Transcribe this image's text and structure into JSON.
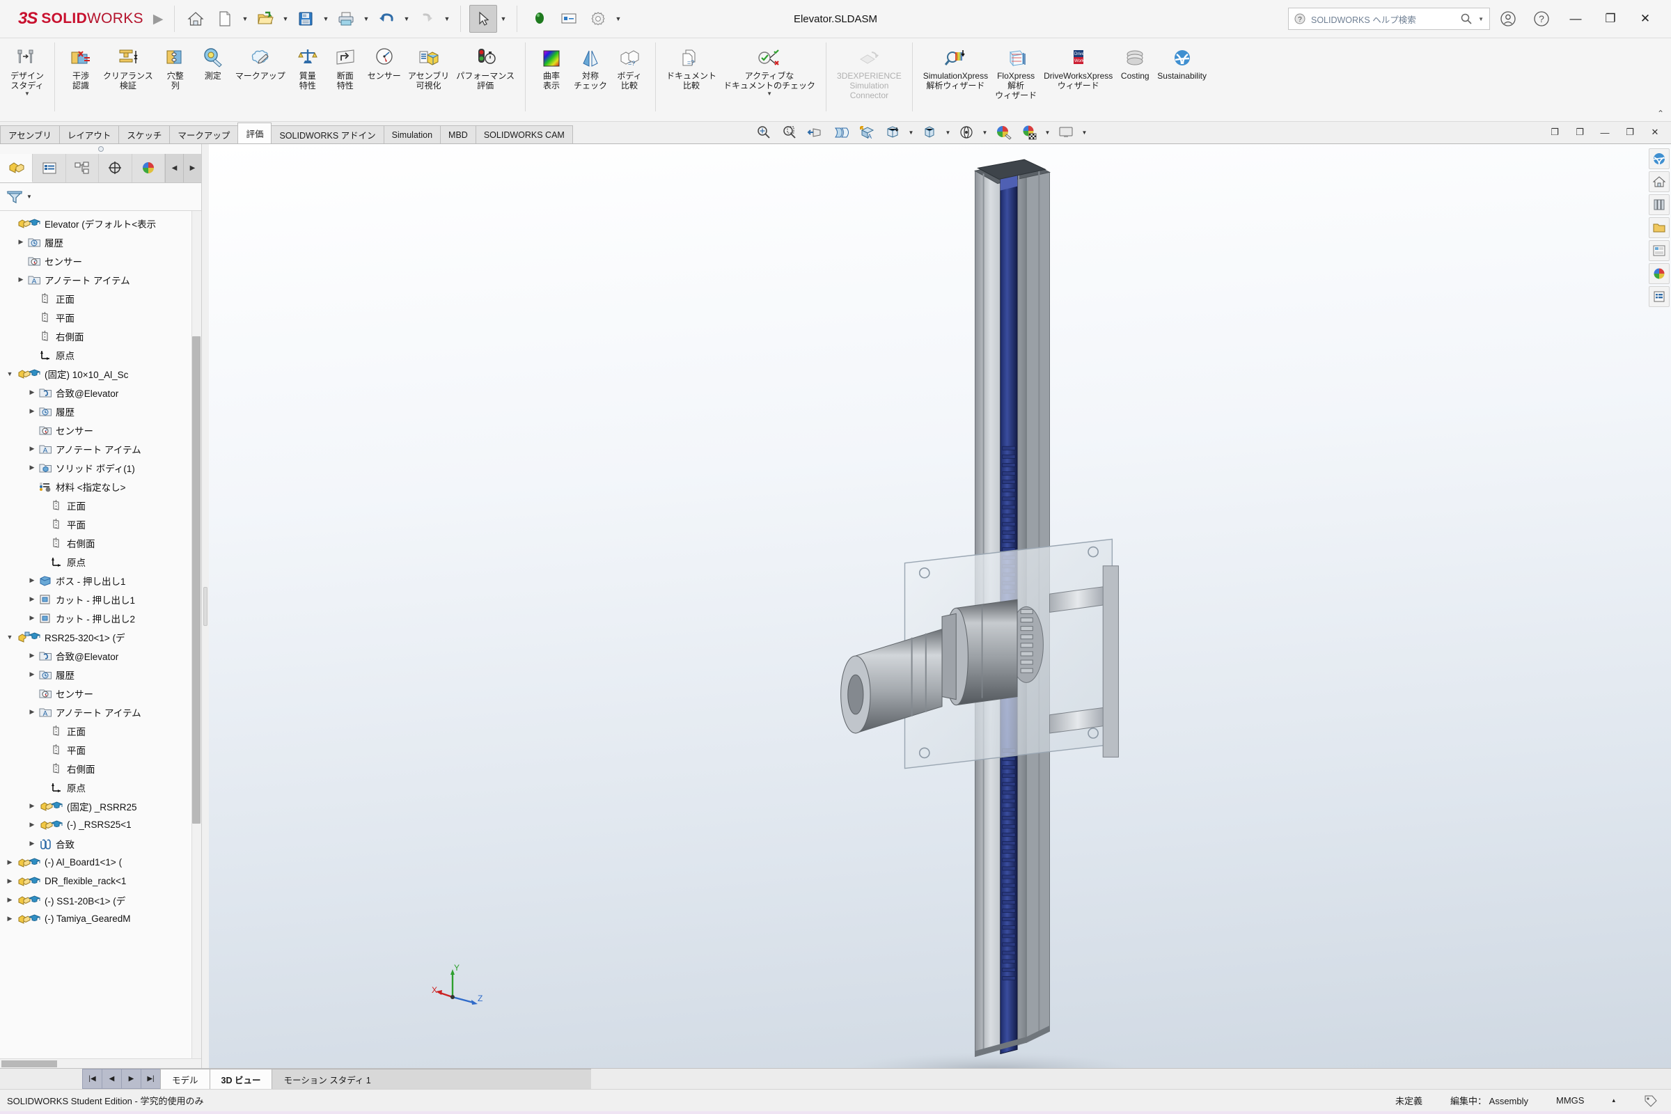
{
  "window": {
    "brand_ds": "3S",
    "brand_solid": "SOLID",
    "brand_works": "WORKS",
    "document_title": "Elevator.SLDASM",
    "search_placeholder": "SOLIDWORKS ヘルプ検索",
    "minimize_label": "—",
    "restore_label": "❐",
    "close_label": "✕"
  },
  "quick_access": [
    {
      "name": "home-icon",
      "label": "ホーム"
    },
    {
      "name": "new-document-icon",
      "label": "新規"
    },
    {
      "name": "open-document-icon",
      "label": "開く"
    },
    {
      "name": "save-icon",
      "label": "保存"
    },
    {
      "name": "print-icon",
      "label": "印刷"
    },
    {
      "name": "undo-icon",
      "label": "元に戻す"
    },
    {
      "name": "redo-icon",
      "label": "やり直し"
    },
    {
      "name": "select-icon",
      "label": "選択"
    },
    {
      "name": "rebuild-icon",
      "label": "再構築"
    },
    {
      "name": "options-display-icon",
      "label": "表示設定"
    },
    {
      "name": "settings-gear-icon",
      "label": "オプション"
    }
  ],
  "ribbon": {
    "groups": [
      {
        "items": [
          {
            "label": "デザイン\nスタディ",
            "icon": "design-study-icon",
            "disabled": false,
            "dropdown": true
          }
        ]
      },
      {
        "items": [
          {
            "label": "干渉\n認識",
            "icon": "interference-detection-icon"
          },
          {
            "label": "クリアランス\n検証",
            "icon": "clearance-verification-icon"
          },
          {
            "label": "穴整\n列",
            "icon": "hole-alignment-icon"
          },
          {
            "label": "測定",
            "icon": "measure-icon"
          },
          {
            "label": "マークアップ",
            "icon": "markup-icon"
          },
          {
            "label": "質量\n特性",
            "icon": "mass-properties-icon"
          },
          {
            "label": "断面\n特性",
            "icon": "section-properties-icon"
          },
          {
            "label": "センサー",
            "icon": "sensor-icon"
          },
          {
            "label": "アセンブリ\n可視化",
            "icon": "assembly-visualization-icon"
          },
          {
            "label": "パフォーマンス\n評価",
            "icon": "performance-evaluation-icon"
          }
        ]
      },
      {
        "items": [
          {
            "label": "曲率\n表示",
            "icon": "curvature-display-icon"
          },
          {
            "label": "対称\nチェック",
            "icon": "symmetry-check-icon"
          },
          {
            "label": "ボディ\n比較",
            "icon": "body-compare-icon"
          }
        ]
      },
      {
        "items": [
          {
            "label": "ドキュメント\n比較",
            "icon": "document-compare-icon"
          },
          {
            "label": "アクティブな\nドキュメントのチェック",
            "icon": "active-document-check-icon",
            "dropdown": true
          }
        ]
      },
      {
        "items": [
          {
            "label": "3DEXPERIENCE\nSimulation\nConnector",
            "icon": "3dexperience-simulation-icon",
            "disabled": true
          }
        ]
      },
      {
        "items": [
          {
            "label": "SimulationXpress\n解析ウィザード",
            "icon": "simulationxpress-icon"
          },
          {
            "label": "FloXpress\n解析\nウィザード",
            "icon": "floxpress-icon"
          },
          {
            "label": "DriveWorksXpress\nウィザード",
            "icon": "driveworksxpress-icon"
          },
          {
            "label": "Costing",
            "icon": "costing-icon"
          },
          {
            "label": "Sustainability",
            "icon": "sustainability-icon"
          }
        ]
      }
    ],
    "collapse_label": "⌃"
  },
  "command_tabs": [
    {
      "label": "アセンブリ",
      "active": false
    },
    {
      "label": "レイアウト",
      "active": false
    },
    {
      "label": "スケッチ",
      "active": false
    },
    {
      "label": "マークアップ",
      "active": false
    },
    {
      "label": "評価",
      "active": true
    },
    {
      "label": "SOLIDWORKS アドイン",
      "active": false
    },
    {
      "label": "Simulation",
      "active": false
    },
    {
      "label": "MBD",
      "active": false
    },
    {
      "label": "SOLIDWORKS CAM",
      "active": false
    }
  ],
  "view_toolbar": [
    {
      "name": "zoom-to-fit-icon",
      "dropdown": false
    },
    {
      "name": "zoom-to-area-icon",
      "dropdown": false
    },
    {
      "name": "previous-view-icon",
      "dropdown": false
    },
    {
      "name": "section-view-icon",
      "dropdown": false
    },
    {
      "name": "view-orientation-icon",
      "dropdown": false
    },
    {
      "name": "display-style-icon",
      "dropdown": true
    },
    {
      "name": "hide-show-items-icon",
      "dropdown": true
    },
    {
      "name": "edit-appearance-icon",
      "dropdown": false
    },
    {
      "name": "apply-scene-icon",
      "dropdown": true
    },
    {
      "name": "view-settings-icon",
      "dropdown": true
    }
  ],
  "document_window_controls": [
    {
      "name": "restore-doc-icon",
      "label": "❐"
    },
    {
      "name": "doc-window-icon",
      "label": "❐"
    },
    {
      "name": "minimize-doc-icon",
      "label": "—"
    },
    {
      "name": "maximize-doc-icon",
      "label": "❐"
    },
    {
      "name": "close-doc-icon",
      "label": "✕"
    }
  ],
  "feature_manager": {
    "tabs": [
      {
        "name": "feature-manager-tab",
        "active": true
      },
      {
        "name": "property-manager-tab",
        "active": false
      },
      {
        "name": "configuration-manager-tab",
        "active": false
      },
      {
        "name": "dimxpert-manager-tab",
        "active": false
      },
      {
        "name": "display-manager-tab",
        "active": false
      },
      {
        "name": "appearances-tab",
        "active": false
      }
    ],
    "nav_prev": "◀",
    "nav_next": "▶",
    "filter_placeholder": "",
    "tree": [
      {
        "label": "Elevator  (デフォルト<表示",
        "indent": 0,
        "arrow": "",
        "icon": "assembly-icon",
        "student": true
      },
      {
        "label": "履歴",
        "indent": 1,
        "arrow": "▶",
        "icon": "history-folder-icon"
      },
      {
        "label": "センサー",
        "indent": 1,
        "arrow": "",
        "icon": "sensor-folder-icon"
      },
      {
        "label": "アノテート アイテム",
        "indent": 1,
        "arrow": "▶",
        "icon": "annotations-folder-icon"
      },
      {
        "label": "正面",
        "indent": 2,
        "arrow": "",
        "icon": "plane-icon"
      },
      {
        "label": "平面",
        "indent": 2,
        "arrow": "",
        "icon": "plane-icon"
      },
      {
        "label": "右側面",
        "indent": 2,
        "arrow": "",
        "icon": "plane-icon"
      },
      {
        "label": "原点",
        "indent": 2,
        "arrow": "",
        "icon": "origin-icon"
      },
      {
        "label": "(固定) 10×10_Al_Sc",
        "indent": 0,
        "arrow": "▼",
        "icon": "part-icon",
        "student": true
      },
      {
        "label": "合致@Elevator",
        "indent": 2,
        "arrow": "▶",
        "icon": "mates-folder-icon"
      },
      {
        "label": "履歴",
        "indent": 2,
        "arrow": "▶",
        "icon": "history-folder-icon"
      },
      {
        "label": "センサー",
        "indent": 2,
        "arrow": "",
        "icon": "sensor-folder-icon"
      },
      {
        "label": "アノテート アイテム",
        "indent": 2,
        "arrow": "▶",
        "icon": "annotations-folder-icon"
      },
      {
        "label": "ソリッド ボディ(1)",
        "indent": 2,
        "arrow": "▶",
        "icon": "solid-bodies-folder-icon"
      },
      {
        "label": "材料 <指定なし>",
        "indent": 2,
        "arrow": "",
        "icon": "material-icon"
      },
      {
        "label": "正面",
        "indent": 3,
        "arrow": "",
        "icon": "plane-icon"
      },
      {
        "label": "平面",
        "indent": 3,
        "arrow": "",
        "icon": "plane-icon"
      },
      {
        "label": "右側面",
        "indent": 3,
        "arrow": "",
        "icon": "plane-icon"
      },
      {
        "label": "原点",
        "indent": 3,
        "arrow": "",
        "icon": "origin-icon"
      },
      {
        "label": "ボス - 押し出し1",
        "indent": 2,
        "arrow": "▶",
        "icon": "boss-extrude-icon"
      },
      {
        "label": "カット - 押し出し1",
        "indent": 2,
        "arrow": "▶",
        "icon": "cut-extrude-icon"
      },
      {
        "label": "カット - 押し出し2",
        "indent": 2,
        "arrow": "▶",
        "icon": "cut-extrude-icon"
      },
      {
        "label": "RSR25-320<1> (デ",
        "indent": 0,
        "arrow": "▼",
        "icon": "subassembly-icon",
        "student": true
      },
      {
        "label": "合致@Elevator",
        "indent": 2,
        "arrow": "▶",
        "icon": "mates-folder-icon"
      },
      {
        "label": "履歴",
        "indent": 2,
        "arrow": "▶",
        "icon": "history-folder-icon"
      },
      {
        "label": "センサー",
        "indent": 2,
        "arrow": "",
        "icon": "sensor-folder-icon"
      },
      {
        "label": "アノテート アイテム",
        "indent": 2,
        "arrow": "▶",
        "icon": "annotations-folder-icon"
      },
      {
        "label": "正面",
        "indent": 3,
        "arrow": "",
        "icon": "plane-icon"
      },
      {
        "label": "平面",
        "indent": 3,
        "arrow": "",
        "icon": "plane-icon"
      },
      {
        "label": "右側面",
        "indent": 3,
        "arrow": "",
        "icon": "plane-icon"
      },
      {
        "label": "原点",
        "indent": 3,
        "arrow": "",
        "icon": "origin-icon"
      },
      {
        "label": "(固定) _RSRR25",
        "indent": 2,
        "arrow": "▶",
        "icon": "part-icon",
        "student": true
      },
      {
        "label": "(-) _RSRS25<1",
        "indent": 2,
        "arrow": "▶",
        "icon": "part-icon",
        "student": true
      },
      {
        "label": "合致",
        "indent": 2,
        "arrow": "▶",
        "icon": "mates-icon"
      },
      {
        "label": "(-) Al_Board1<1> (",
        "indent": 0,
        "arrow": "▶",
        "icon": "part-icon",
        "student": true
      },
      {
        "label": "DR_flexible_rack<1",
        "indent": 0,
        "arrow": "▶",
        "icon": "part-icon",
        "student": true
      },
      {
        "label": "(-) SS1-20B<1> (デ",
        "indent": 0,
        "arrow": "▶",
        "icon": "part-icon",
        "student": true
      },
      {
        "label": "(-) Tamiya_GearedM",
        "indent": 0,
        "arrow": "▶",
        "icon": "part-icon",
        "student": true
      }
    ]
  },
  "graphics": {
    "triad": {
      "x_label": "X",
      "y_label": "Y",
      "z_label": "Z"
    },
    "right_toolbar": [
      {
        "name": "view-palette-icon"
      },
      {
        "name": "appearances-home-icon"
      },
      {
        "name": "scenes-lights-icon"
      },
      {
        "name": "design-library-icon"
      },
      {
        "name": "file-explorer-icon"
      },
      {
        "name": "search-library-icon"
      },
      {
        "name": "view-palette2-icon"
      },
      {
        "name": "appearances-panel-icon"
      },
      {
        "name": "custom-properties-icon"
      }
    ]
  },
  "bottom": {
    "nav_first": "|◀",
    "nav_prev": "◀",
    "nav_next": "▶",
    "nav_last": "▶|",
    "tabs": [
      {
        "label": "モデル",
        "active": false,
        "plain": true
      },
      {
        "label": "3D ビュー",
        "active": true
      },
      {
        "label": "モーション スタディ 1",
        "active": false
      }
    ]
  },
  "status": {
    "license": "SOLIDWORKS Student Edition - 学究的使用のみ",
    "state": "未定義",
    "editing": "編集中： Assembly",
    "units": "MMGS",
    "units_caret": "▴"
  }
}
